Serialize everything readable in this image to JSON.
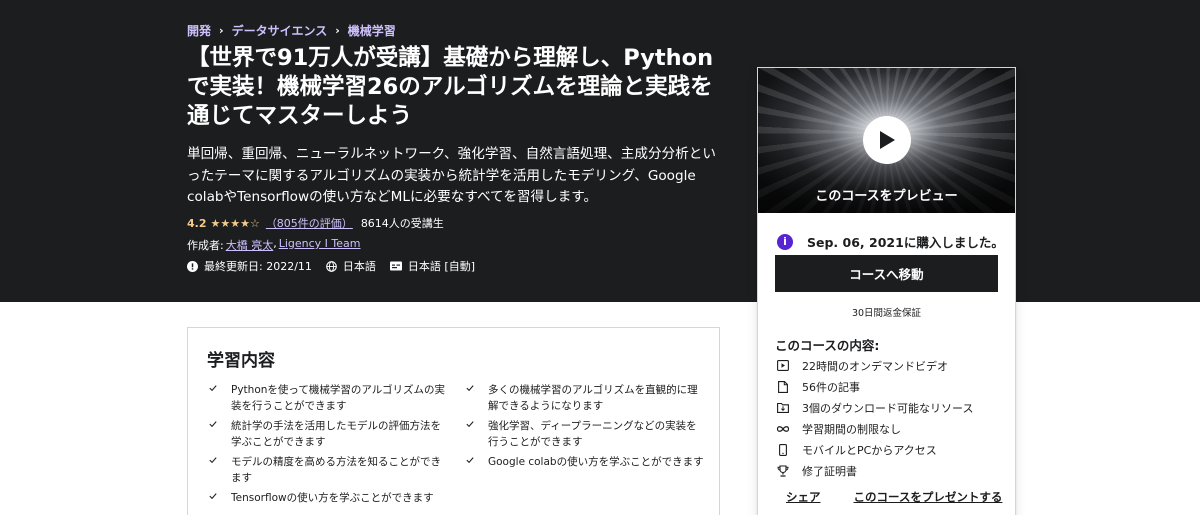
{
  "breadcrumb": [
    "開発",
    "データサイエンス",
    "機械学習"
  ],
  "course": {
    "title": "【世界で91万人が受講】基礎から理解し、Pythonで実装！機械学習26のアルゴリズムを理論と実践を通じてマスターしよう",
    "subtitle": "単回帰、重回帰、ニューラルネットワーク、強化学習、自然言語処理、主成分分析といったテーマに関するアルゴリズムの実装から統計学を活用したモデリング、Google colabやTensorflowの使い方などMLに必要なすべてを習得します。",
    "rating": "4.2",
    "stars": "★★★★☆",
    "rating_count": "（805件の評価）",
    "students": "8614人の受講生",
    "author_label": "作成者:",
    "authors": "大橋 亮太",
    "author_sep": ",",
    "author2": "Ligency I Team",
    "updated": "最終更新日: 2022/11",
    "language": "日本語",
    "captions": "日本語 [自動]"
  },
  "sidebar": {
    "preview_label": "このコースをプレビュー",
    "purchased": "Sep. 06, 2021に購入しました。",
    "go_button": "コースへ移動",
    "guarantee": "30日間返金保証",
    "includes_title": "このコースの内容:",
    "includes": [
      {
        "icon": "video-icon",
        "label": "22時間のオンデマンドビデオ"
      },
      {
        "icon": "file-icon",
        "label": "56件の記事"
      },
      {
        "icon": "download-folder-icon",
        "label": "3個のダウンロード可能なリソース"
      },
      {
        "icon": "infinity-icon",
        "label": "学習期間の制限なし"
      },
      {
        "icon": "mobile-icon",
        "label": "モバイルとPCからアクセス"
      },
      {
        "icon": "trophy-icon",
        "label": "修了証明書"
      }
    ],
    "share": "シェア",
    "gift": "このコースをプレゼントする"
  },
  "learn": {
    "title": "学習内容",
    "items": [
      "Pythonを使って機械学習のアルゴリズムの実装を行うことができます",
      "多くの機械学習のアルゴリズムを直観的に理解できるようになります",
      "統計学の手法を活用したモデルの評価方法を学ぶことができます",
      "強化学習、ディープラーニングなどの実装を行うことができます",
      "モデルの精度を高める方法を知ることができます",
      "Google colabの使い方を学ぶことができます",
      "Tensorflowの使い方を学ぶことができます"
    ]
  },
  "colors": {
    "hero_bg": "#1c1d1f",
    "link_purple": "#cec0fc",
    "star": "#f3ca8c",
    "accent_purple": "#5624d0"
  }
}
